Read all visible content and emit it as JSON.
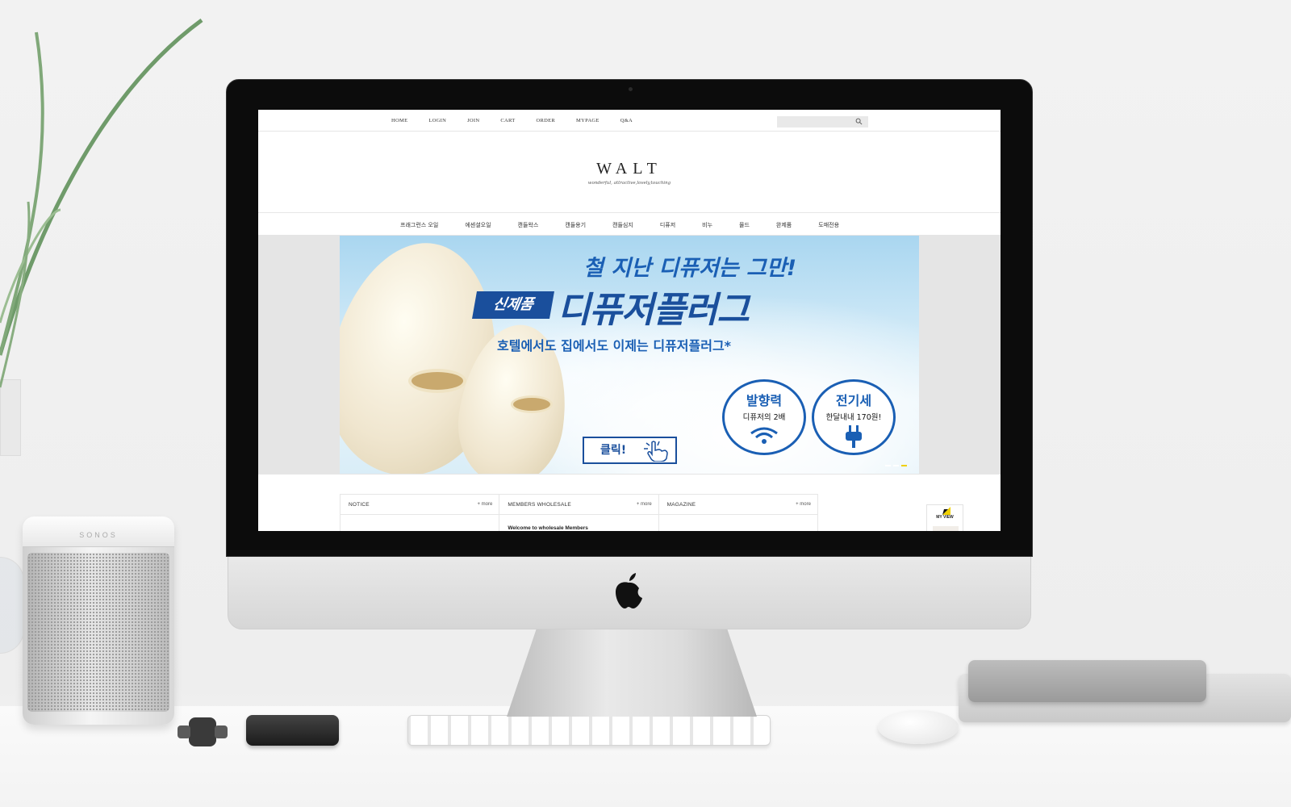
{
  "speaker": {
    "brand": "SONOS"
  },
  "site": {
    "top_nav": [
      "HOME",
      "LOGIN",
      "JOIN",
      "CART",
      "ORDER",
      "MYPAGE",
      "Q&A"
    ],
    "search": {
      "placeholder": "",
      "icon": "search-icon"
    },
    "logo": "WALT",
    "tagline": "wonderful, attractive,lovely,touching",
    "categories": [
      "프래그런스 오일",
      "에센셜오일",
      "캔들왁스",
      "캔들용기",
      "캔들심지",
      "디퓨저",
      "비누",
      "몰드",
      "완제품",
      "도매전용"
    ],
    "banner": {
      "headline": "철 지난 디퓨저는 그만!",
      "ribbon": "신제품",
      "product": "디퓨저플러그",
      "subline": "호텔에서도 집에서도 이제는 디퓨저플러그*",
      "badge1": {
        "title": "발향력",
        "sub": "디퓨저의 2배",
        "icon": "wifi-icon"
      },
      "badge2": {
        "title": "전기세",
        "sub": "한달내내 170원!",
        "icon": "plug-icon"
      },
      "click_label": "클릭!",
      "slides": 3,
      "active_slide": 3,
      "accent": "#1a5fb4",
      "dark_accent": "#1a4f9c"
    },
    "boards": [
      {
        "title": "NOTICE",
        "more": "+ more",
        "item": ""
      },
      {
        "title": "MEMBERS WHOLESALE",
        "more": "+ more",
        "item": "Welcome to wholesale Members"
      },
      {
        "title": "MAGAZINE",
        "more": "+ more",
        "item": ""
      }
    ],
    "my_view": {
      "label": "MY VIEW"
    }
  }
}
